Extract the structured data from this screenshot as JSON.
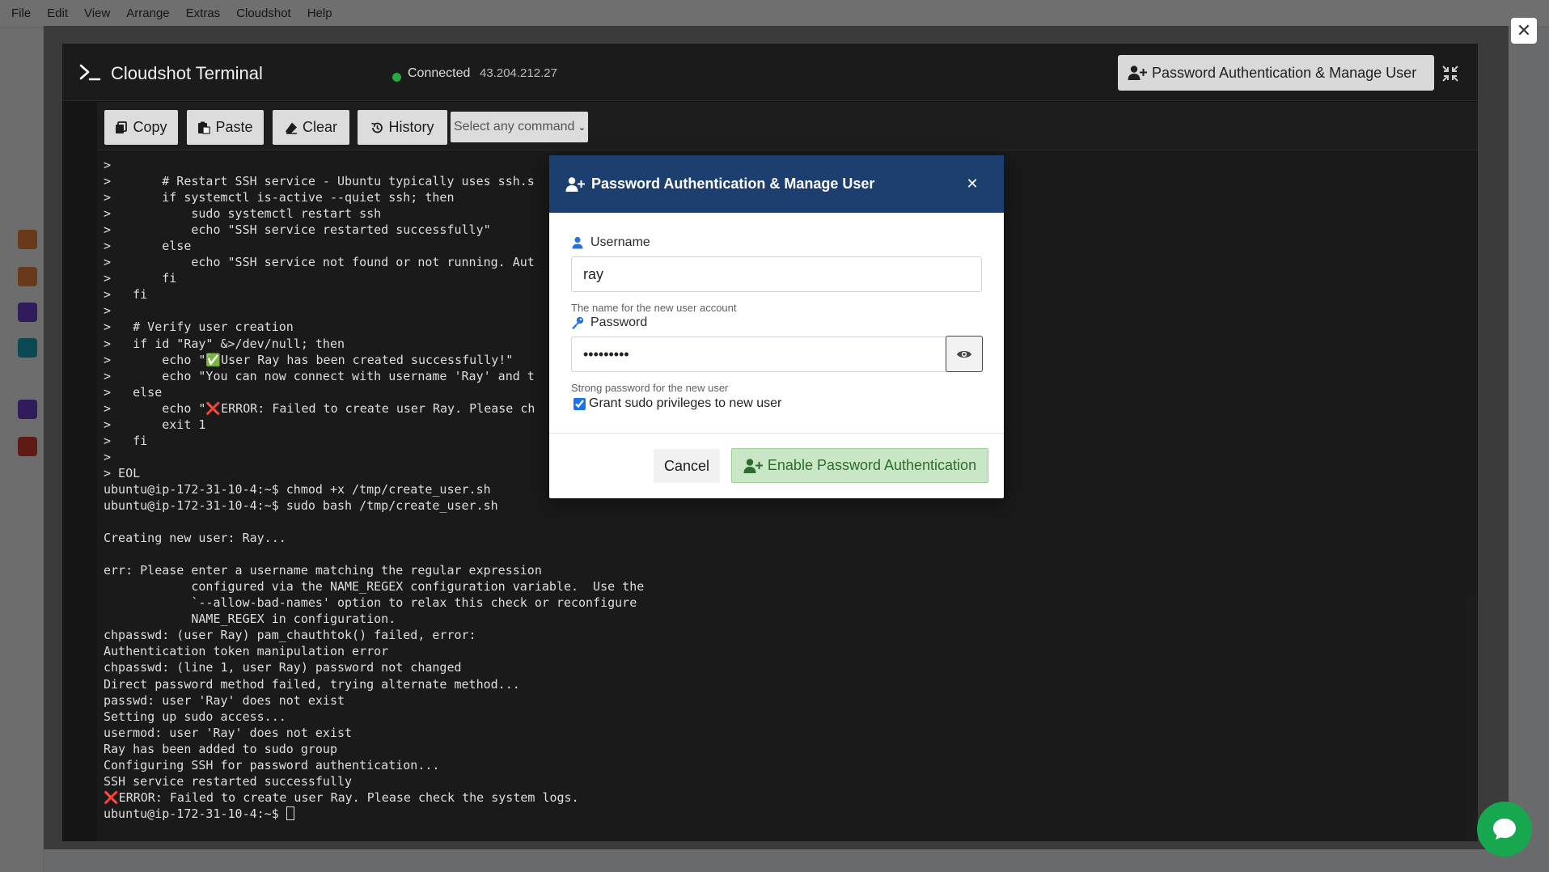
{
  "background_app": {
    "menu_items": [
      "File",
      "Edit",
      "View",
      "Arrange",
      "Extras",
      "Cloudshot",
      "Help"
    ]
  },
  "terminal": {
    "title": "Cloudshot Terminal",
    "connection_status": "Connected",
    "ip_address": "43.204.212.27",
    "header_button_label": "Password Authentication & Manage User",
    "toolbar": {
      "copy": "Copy",
      "paste": "Paste",
      "clear": "Clear",
      "history": "History",
      "command_select_placeholder": "Select any command"
    },
    "output_lines": [
      ">",
      ">       # Restart SSH service - Ubuntu typically uses ssh.s",
      ">       if systemctl is-active --quiet ssh; then",
      ">           sudo systemctl restart ssh",
      ">           echo \"SSH service restarted successfully\"",
      ">       else",
      ">           echo \"SSH service not found or not running. Aut",
      ">       fi",
      ">   fi",
      ">",
      ">   # Verify user creation",
      ">   if id \"Ray\" &>/dev/null; then",
      ">       echo \"✅User Ray has been created successfully!\"",
      ">       echo \"You can now connect with username 'Ray' and t",
      ">   else",
      ">       echo \"❌ERROR: Failed to create user Ray. Please ch",
      ">       exit 1",
      ">   fi",
      ">",
      "> EOL",
      "ubuntu@ip-172-31-10-4:~$ chmod +x /tmp/create_user.sh",
      "ubuntu@ip-172-31-10-4:~$ sudo bash /tmp/create_user.sh",
      "",
      "Creating new user: Ray...",
      "",
      "err: Please enter a username matching the regular expression",
      "            configured via the NAME_REGEX configuration variable.  Use the",
      "            `--allow-bad-names' option to relax this check or reconfigure",
      "            NAME_REGEX in configuration.",
      "chpasswd: (user Ray) pam_chauthtok() failed, error:",
      "Authentication token manipulation error",
      "chpasswd: (line 1, user Ray) password not changed",
      "Direct password method failed, trying alternate method...",
      "passwd: user 'Ray' does not exist",
      "Setting up sudo access...",
      "usermod: user 'Ray' does not exist",
      "Ray has been added to sudo group",
      "Configuring SSH for password authentication...",
      "SSH service restarted successfully",
      "❌ERROR: Failed to create user Ray. Please check the system logs.",
      "ubuntu@ip-172-31-10-4:~$ "
    ]
  },
  "modal": {
    "title": "Password Authentication & Manage User",
    "username_label": "Username",
    "username_value": "ray",
    "username_help": "The name for the new user account",
    "password_label": "Password",
    "password_value": "•••••••••",
    "password_help": "Strong password for the new user",
    "sudo_checkbox_label": "Grant sudo privileges to new user",
    "sudo_checked": true,
    "cancel_label": "Cancel",
    "submit_label": "Enable Password Authentication"
  },
  "colors": {
    "modal_header": "#1c3f6f",
    "submit_bg": "#c9e7c6",
    "submit_text": "#2e6b2e",
    "connected_dot": "#28a745",
    "chat_bubble": "#17a84f"
  }
}
